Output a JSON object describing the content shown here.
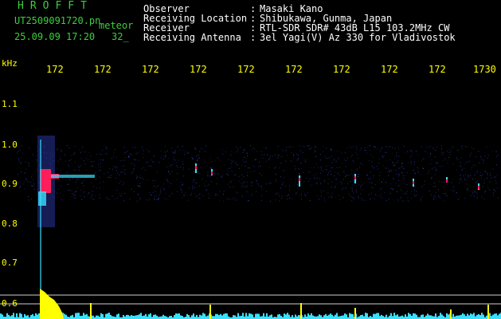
{
  "header": {
    "brand": "HROFFT",
    "file_name": "UT2509091720.pn",
    "mode": "meteor",
    "date_time": "25.09.09 17:20",
    "count": "32_"
  },
  "info": {
    "rows": [
      {
        "label": "Observer",
        "value": "Masaki Kano"
      },
      {
        "label": "Receiving Location",
        "value": "Shibukawa, Gunma, Japan"
      },
      {
        "label": "Receiver",
        "value": "RTL-SDR SDR# 43dB L15 103.2MHz CW"
      },
      {
        "label": "Receiving Antenna",
        "value": "3el Yagi(V) Az 330 for Vladivostok"
      }
    ],
    "separator": ":"
  },
  "axis": {
    "unit": "kHz",
    "y_labels": [
      "1.1",
      "1.0",
      "0.9",
      "0.8",
      "0.7",
      "0.6"
    ],
    "x_labels": [
      "172",
      "172",
      "172",
      "172",
      "172",
      "172",
      "172",
      "172",
      "172",
      "1730"
    ]
  },
  "colors": {
    "text_green": "#3ccf3c",
    "text_white": "#ffffff",
    "axis_yellow": "#ffff00",
    "noise_blue": "#2a3aa8",
    "signal_red": "#ff1e5a",
    "signal_cyan": "#38e0ff",
    "signal_yellow": "#ffff00"
  }
}
